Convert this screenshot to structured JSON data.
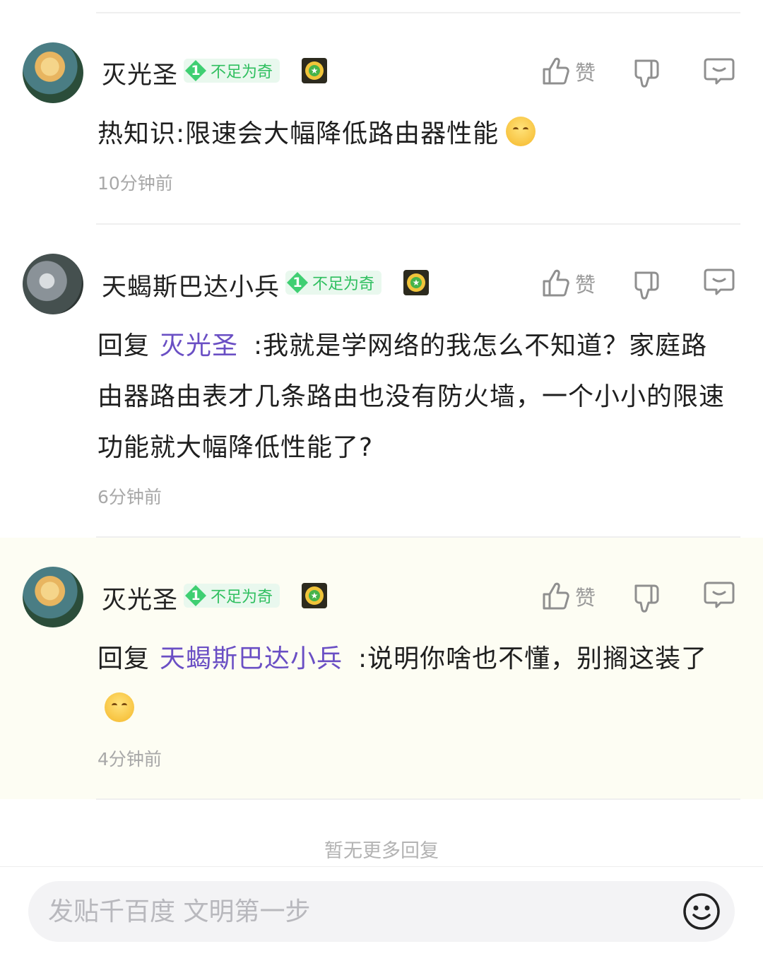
{
  "comments": [
    {
      "username": "灭光圣",
      "level": "1",
      "level_title": "不足为奇",
      "like_label": "赞",
      "text": "热知识:限速会大幅降低路由器性能",
      "time": "10分钟前"
    },
    {
      "username": "天蝎斯巴达小兵",
      "level": "1",
      "level_title": "不足为奇",
      "like_label": "赞",
      "reply_prefix": "回复",
      "mention": "灭光圣",
      "text": ":我就是学网络的我怎么不知道？家庭路由器路由表才几条路由也没有防火墙，一个小小的限速功能就大幅降低性能了?",
      "time": "6分钟前"
    },
    {
      "username": "灭光圣",
      "level": "1",
      "level_title": "不足为奇",
      "like_label": "赞",
      "reply_prefix": "回复",
      "mention": "天蝎斯巴达小兵",
      "text": ":说明你啥也不懂，别搁这装了",
      "time": "4分钟前"
    }
  ],
  "footer_note": "暂无更多回复",
  "input": {
    "placeholder": "发贴千百度 文明第一步"
  },
  "colors": {
    "mention": "#6a4fc4",
    "level_badge": "#3fcf72",
    "highlight_bg": "#fdfdf3"
  },
  "icons": [
    "thumbs-up-icon",
    "thumbs-down-icon",
    "comment-bubble-icon",
    "medal-icon",
    "smile-emoji-icon",
    "emoji-face-icon"
  ]
}
